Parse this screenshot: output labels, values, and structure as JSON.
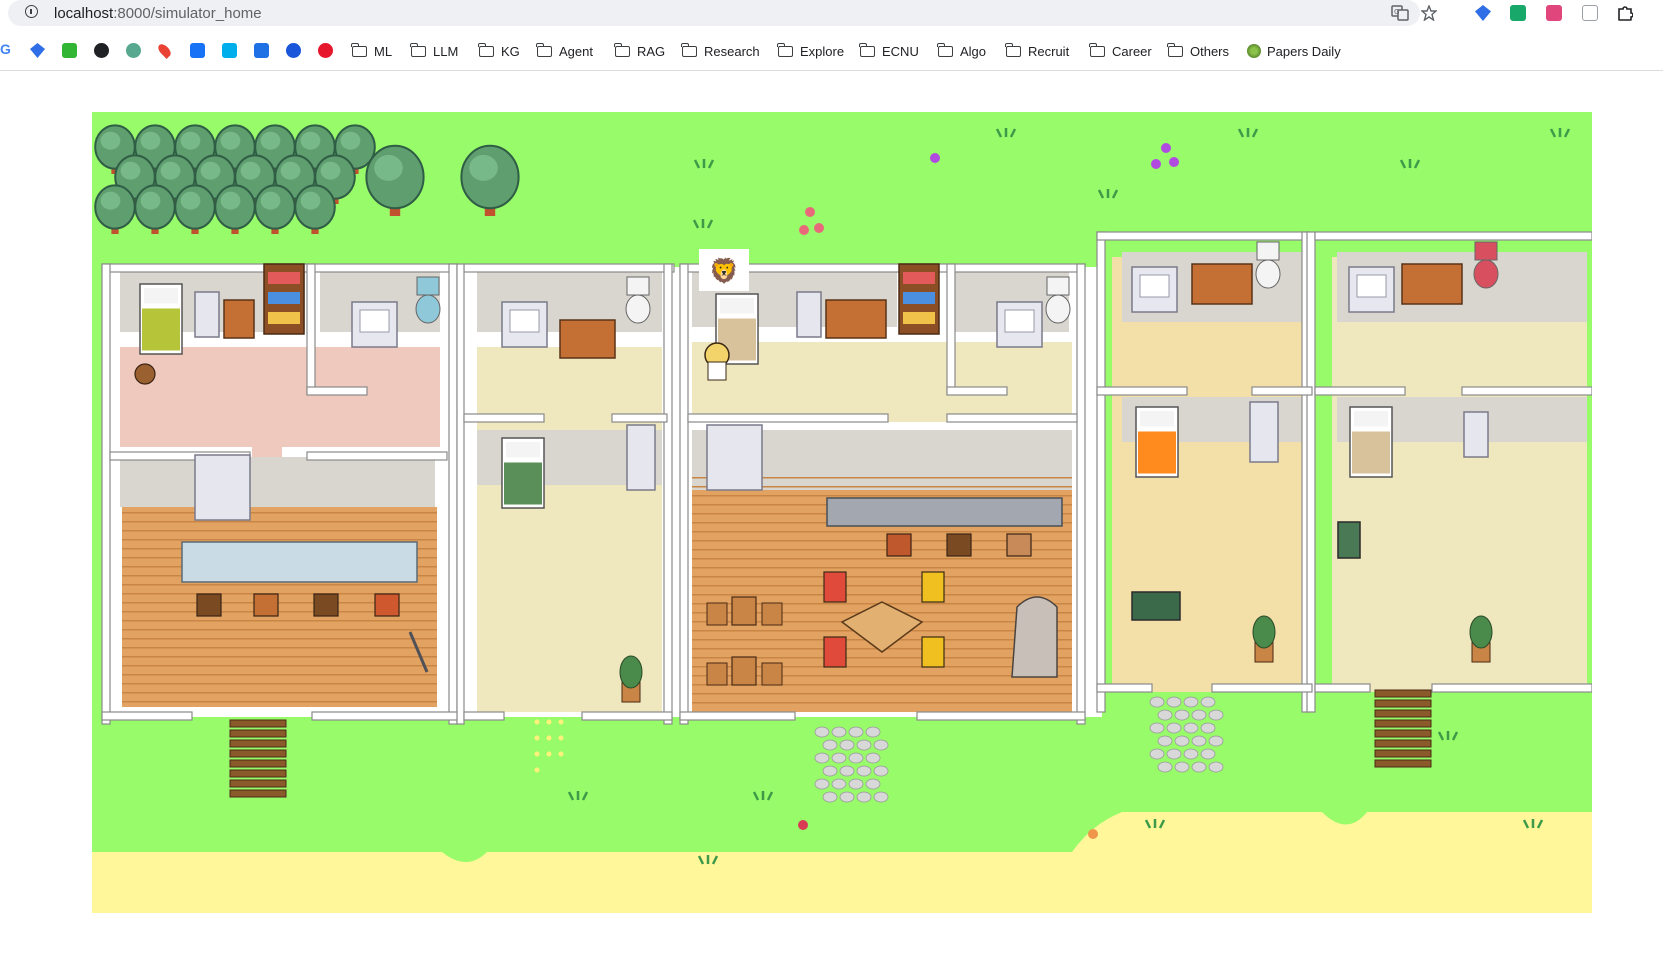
{
  "browser": {
    "url_host": "localhost",
    "url_path": ":8000/simulator_home",
    "bookmarks": [
      "ML",
      "LLM",
      "KG",
      "Agent",
      "RAG",
      "Research",
      "Explore",
      "ECNU",
      "Algo",
      "Recruit",
      "Career",
      "Others",
      "Papers Daily"
    ]
  },
  "game": {
    "character_emoji": "🦁",
    "colors": {
      "grass": "#98fb6a",
      "sand": "#fff79a",
      "wall": "#ffffff",
      "wood_floor": "#e2a261",
      "tile_floor": "#efe7bd",
      "pink_floor": "#efc9bd"
    }
  }
}
